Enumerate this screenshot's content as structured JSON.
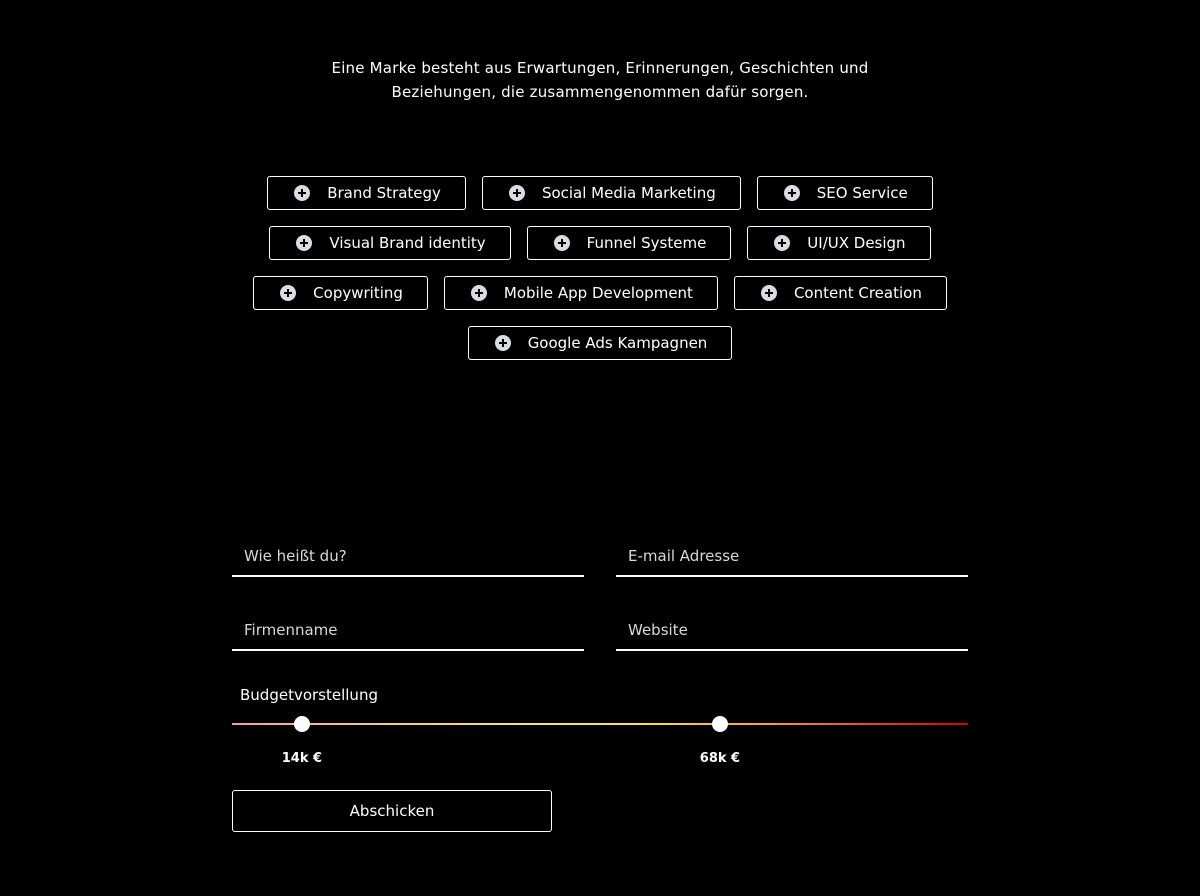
{
  "intro": {
    "line1": "Eine Marke besteht aus Erwartungen, Erinnerungen, Geschichten und",
    "line2": "Beziehungen, die zusammengenommen dafür sorgen."
  },
  "services": {
    "row1": [
      "Brand Strategy",
      "Social Media Marketing",
      "SEO Service"
    ],
    "row2": [
      "Visual Brand identity",
      "Funnel Systeme",
      "UI/UX Design"
    ],
    "row3": [
      "Copywriting",
      "Mobile App Development",
      "Content Creation"
    ],
    "row4": [
      "Google Ads Kampagnen"
    ]
  },
  "form": {
    "name_placeholder": "Wie heißt du?",
    "email_placeholder": "E-mail Adresse",
    "company_placeholder": "Firmenname",
    "website_placeholder": "Website",
    "budget": {
      "label": "Budgetvorstellung",
      "min_label": "14k €",
      "max_label": "68k €",
      "low_fraction": 0.095,
      "high_fraction": 0.663
    },
    "submit_label": "Abschicken"
  }
}
